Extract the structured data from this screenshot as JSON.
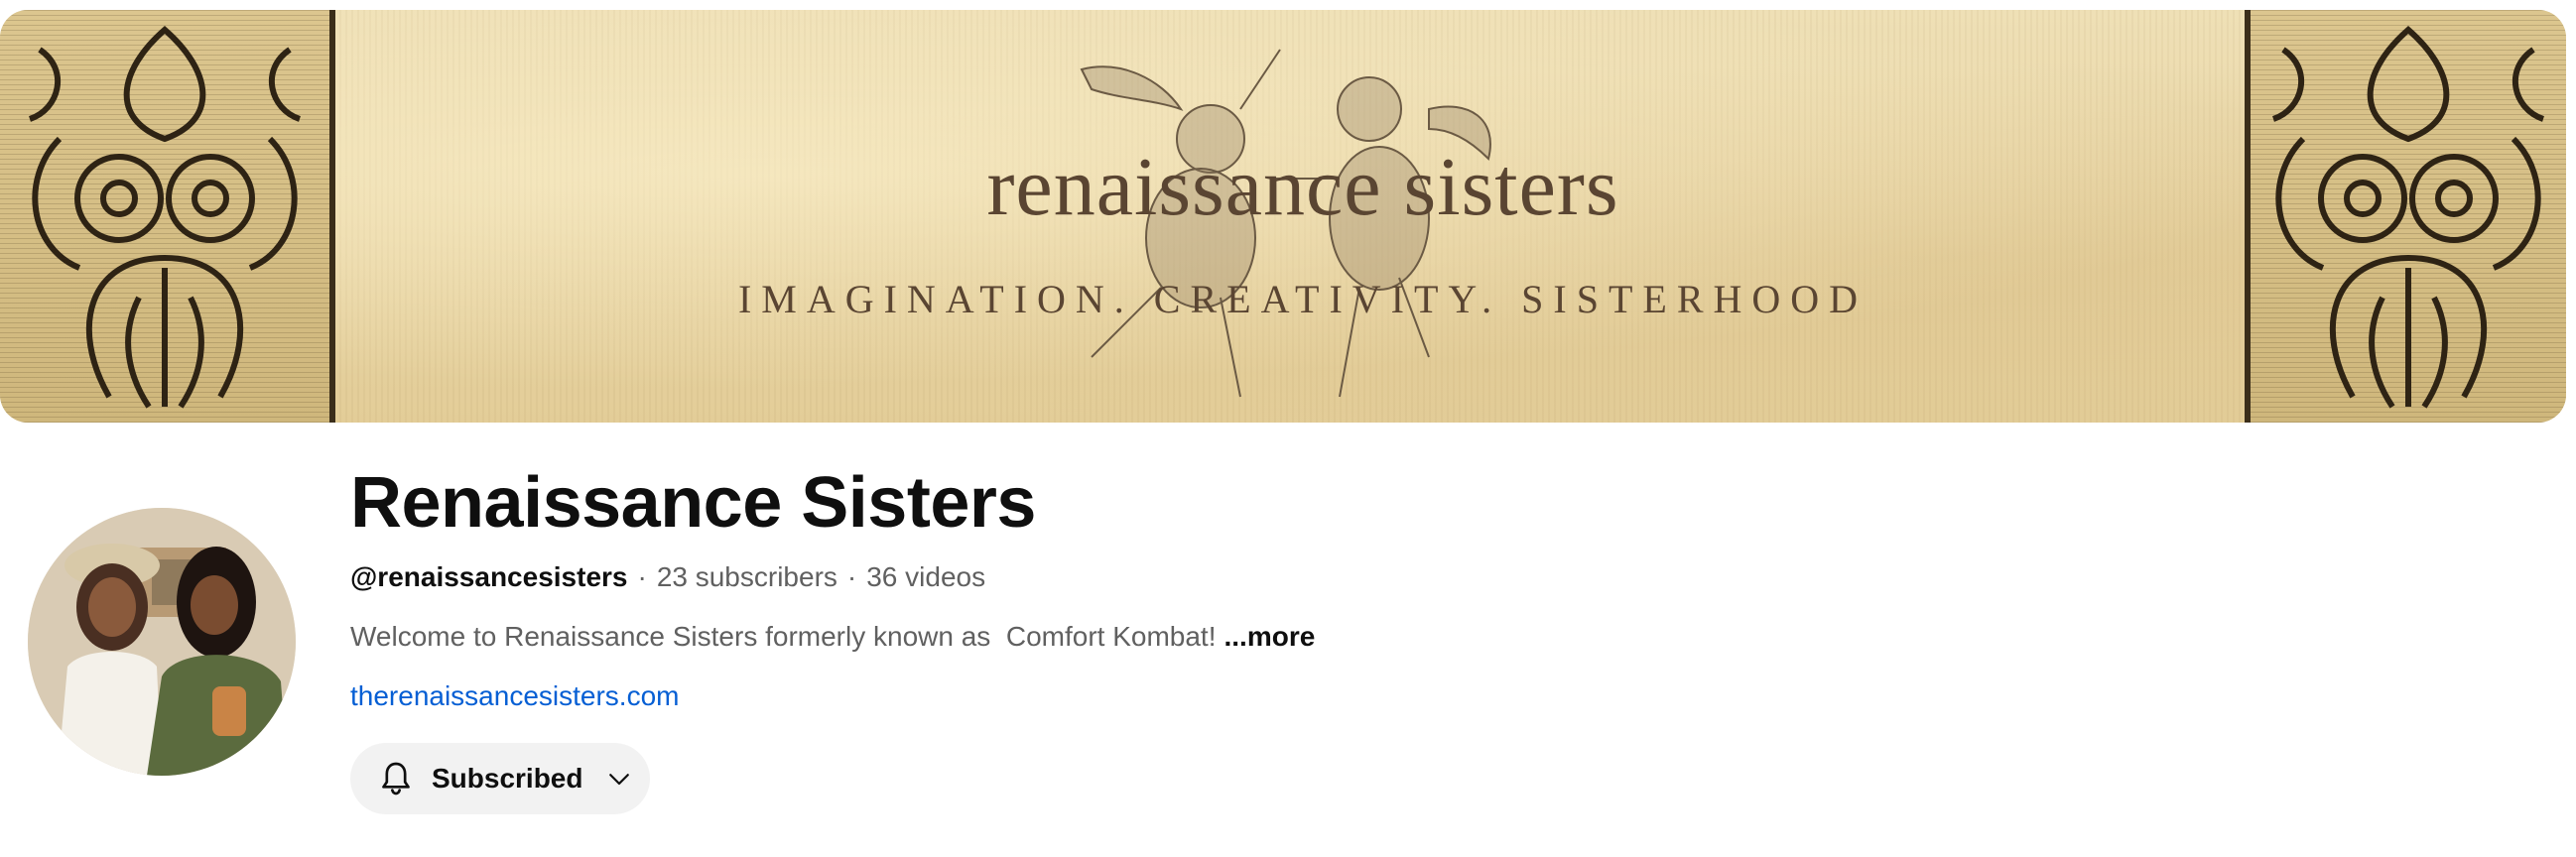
{
  "banner": {
    "title": "renaissance sisters",
    "tagline": "IMAGINATION. CREATIVITY. SISTERHOOD",
    "colors": {
      "parchment": "#e9d6a6",
      "ink": "#5a4532"
    }
  },
  "channel": {
    "name": "Renaissance Sisters",
    "handle": "@renaissancesisters",
    "separator": "·",
    "subscribers": "23 subscribers",
    "videos": "36 videos",
    "description": "Welcome to Renaissance Sisters formerly known as  Comfort Kombat!",
    "more_label": "...more",
    "link": "therenaissancesisters.com",
    "avatar_icon": "channel-avatar"
  },
  "subscribe_button": {
    "label": "Subscribed",
    "icon_left": "bell-icon",
    "icon_right": "chevron-down-icon",
    "colors": {
      "background": "#f2f2f2",
      "text": "#0f0f0f",
      "link": "#065fd4"
    }
  }
}
